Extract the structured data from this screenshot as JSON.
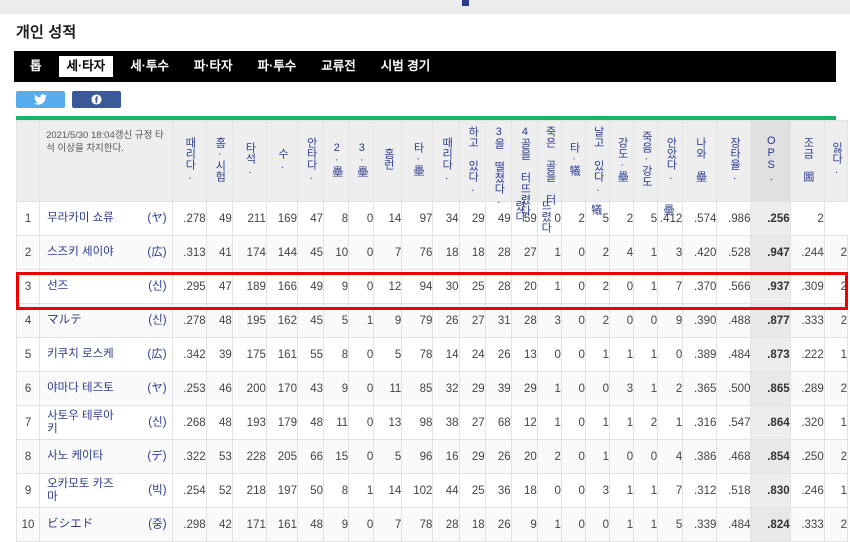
{
  "page": {
    "title": "개인 성적"
  },
  "nav": {
    "tabs": [
      {
        "label": "톱",
        "active": false
      },
      {
        "label": "세·타자",
        "active": true
      },
      {
        "label": "세·투수",
        "active": false
      },
      {
        "label": "파·타자",
        "active": false
      },
      {
        "label": "파·투수",
        "active": false
      },
      {
        "label": "교류전",
        "active": false
      },
      {
        "label": "시범 경기",
        "active": false
      }
    ]
  },
  "share": {
    "twitter_label": "twitter-share",
    "facebook_label": "facebook-share",
    "twitter_color": "#55acee",
    "facebook_color": "#3b5998"
  },
  "table": {
    "caption": "2021/5/30 18:04갱신 규정 타석 이상을 차지한다.",
    "accent_color": "#18b368",
    "highlight_color": "#ee0000",
    "highlighted_rank": 3,
    "headers": [
      {
        "key": "rank",
        "label": "",
        "vertical": false
      },
      {
        "key": "caption",
        "label": "2021/5/30 18:04갱신 규정 타석 이상을 차지한다.",
        "vertical": false
      },
      {
        "key": "avg",
        "label": "때리다.",
        "vertical": true
      },
      {
        "key": "games",
        "label": "홈·시험",
        "vertical": true
      },
      {
        "key": "pa",
        "label": "타석.",
        "vertical": true
      },
      {
        "key": "ab",
        "label": "수.",
        "vertical": true
      },
      {
        "key": "h",
        "label": "안타다.",
        "vertical": true
      },
      {
        "key": "b2",
        "label": "2·壘",
        "vertical": true
      },
      {
        "key": "b3",
        "label": "3·壘",
        "vertical": true
      },
      {
        "key": "hr",
        "label": "홈런",
        "vertical": true
      },
      {
        "key": "tb",
        "label": "타·壘",
        "vertical": true
      },
      {
        "key": "rbi",
        "label": "때리다.",
        "vertical": true
      },
      {
        "key": "r",
        "label": "하고 있다.",
        "vertical": true
      },
      {
        "key": "k",
        "label": "3을 떨쳤다.",
        "vertical": true
      },
      {
        "key": "bb",
        "label": "4골을 터뜨렸다",
        "vertical": true
      },
      {
        "key": "ibb",
        "label": "죽은 골을 터",
        "vertical": true
      },
      {
        "key": "hbp",
        "label": "타·犧",
        "vertical": true
      },
      {
        "key": "sh",
        "label": "날고 있다.",
        "vertical": true
      },
      {
        "key": "sf",
        "label": "강도·壘",
        "vertical": true
      },
      {
        "key": "sb",
        "label": "죽음·강도",
        "vertical": true
      },
      {
        "key": "cs",
        "label": "안았다.",
        "vertical": true
      },
      {
        "key": "gdp",
        "label": "나와 壘",
        "vertical": true
      },
      {
        "key": "slg",
        "label": "장타율.",
        "vertical": true
      },
      {
        "key": "ops",
        "label": "OPS.",
        "vertical": true
      },
      {
        "key": "obp2",
        "label": "조금 圌",
        "vertical": true
      },
      {
        "key": "lost",
        "label": "잃다.",
        "vertical": true
      }
    ],
    "rows": [
      {
        "rank": "1",
        "name": "무라카미 쇼류",
        "team": "(ヤ)",
        "values": [
          ".278",
          "49",
          "211",
          "169",
          "47",
          "8",
          "0",
          "14",
          "97",
          "34",
          "29",
          "49",
          "59",
          "0",
          "2",
          "5",
          "2",
          "5",
          ".412",
          ".574",
          ".986",
          ".256",
          "2"
        ]
      },
      {
        "rank": "2",
        "name": "스즈키 세이야",
        "team": "(広)",
        "values": [
          ".313",
          "41",
          "174",
          "144",
          "45",
          "10",
          "0",
          "7",
          "76",
          "18",
          "18",
          "28",
          "27",
          "1",
          "0",
          "2",
          "4",
          "1",
          "3",
          ".420",
          ".528",
          ".947",
          ".244",
          "2"
        ]
      },
      {
        "rank": "3",
        "name": "선즈",
        "team": "(신)",
        "values": [
          ".295",
          "47",
          "189",
          "166",
          "49",
          "9",
          "0",
          "12",
          "94",
          "30",
          "25",
          "28",
          "20",
          "1",
          "0",
          "2",
          "0",
          "1",
          "7",
          ".370",
          ".566",
          ".937",
          ".309",
          "2"
        ]
      },
      {
        "rank": "4",
        "name": "マルテ",
        "team": "(신)",
        "values": [
          ".278",
          "48",
          "195",
          "162",
          "45",
          "5",
          "1",
          "9",
          "79",
          "26",
          "27",
          "31",
          "28",
          "3",
          "0",
          "2",
          "0",
          "0",
          "9",
          ".390",
          ".488",
          ".877",
          ".333",
          "2"
        ]
      },
      {
        "rank": "5",
        "name": "키쿠치 로스케",
        "team": "(広)",
        "values": [
          ".342",
          "39",
          "175",
          "161",
          "55",
          "8",
          "0",
          "5",
          "78",
          "14",
          "24",
          "26",
          "13",
          "0",
          "0",
          "1",
          "1",
          "1",
          "0",
          ".389",
          ".484",
          ".873",
          ".222",
          "1"
        ]
      },
      {
        "rank": "6",
        "name": "야마다 테즈토",
        "team": "(ヤ)",
        "values": [
          ".253",
          "46",
          "200",
          "170",
          "43",
          "9",
          "0",
          "11",
          "85",
          "32",
          "29",
          "39",
          "29",
          "1",
          "0",
          "0",
          "3",
          "1",
          "2",
          ".365",
          ".500",
          ".865",
          ".289",
          "2"
        ]
      },
      {
        "rank": "7",
        "name": "사토우 테루아키",
        "team": "(신)",
        "values": [
          ".268",
          "48",
          "193",
          "179",
          "48",
          "11",
          "0",
          "13",
          "98",
          "38",
          "27",
          "68",
          "12",
          "1",
          "0",
          "1",
          "1",
          "2",
          "1",
          ".316",
          ".547",
          ".864",
          ".320",
          "1"
        ]
      },
      {
        "rank": "8",
        "name": "사노 케이타",
        "team": "(デ)",
        "values": [
          ".322",
          "53",
          "228",
          "205",
          "66",
          "15",
          "0",
          "5",
          "96",
          "16",
          "29",
          "26",
          "20",
          "2",
          "0",
          "1",
          "0",
          "0",
          "4",
          ".386",
          ".468",
          ".854",
          ".250",
          "2"
        ]
      },
      {
        "rank": "9",
        "name": "오카모토 카즈마",
        "team": "(빅)",
        "values": [
          ".254",
          "52",
          "218",
          "197",
          "50",
          "8",
          "1",
          "14",
          "102",
          "44",
          "25",
          "36",
          "18",
          "0",
          "0",
          "3",
          "1",
          "1",
          "7",
          ".312",
          ".518",
          ".830",
          ".246",
          "1"
        ]
      },
      {
        "rank": "10",
        "name": "ビシエド",
        "team": "(중)",
        "values": [
          ".298",
          "42",
          "171",
          "161",
          "48",
          "9",
          "0",
          "7",
          "78",
          "28",
          "18",
          "26",
          "9",
          "1",
          "0",
          "0",
          "1",
          "1",
          "5",
          ".339",
          ".484",
          ".824",
          ".333",
          "2"
        ]
      }
    ]
  }
}
